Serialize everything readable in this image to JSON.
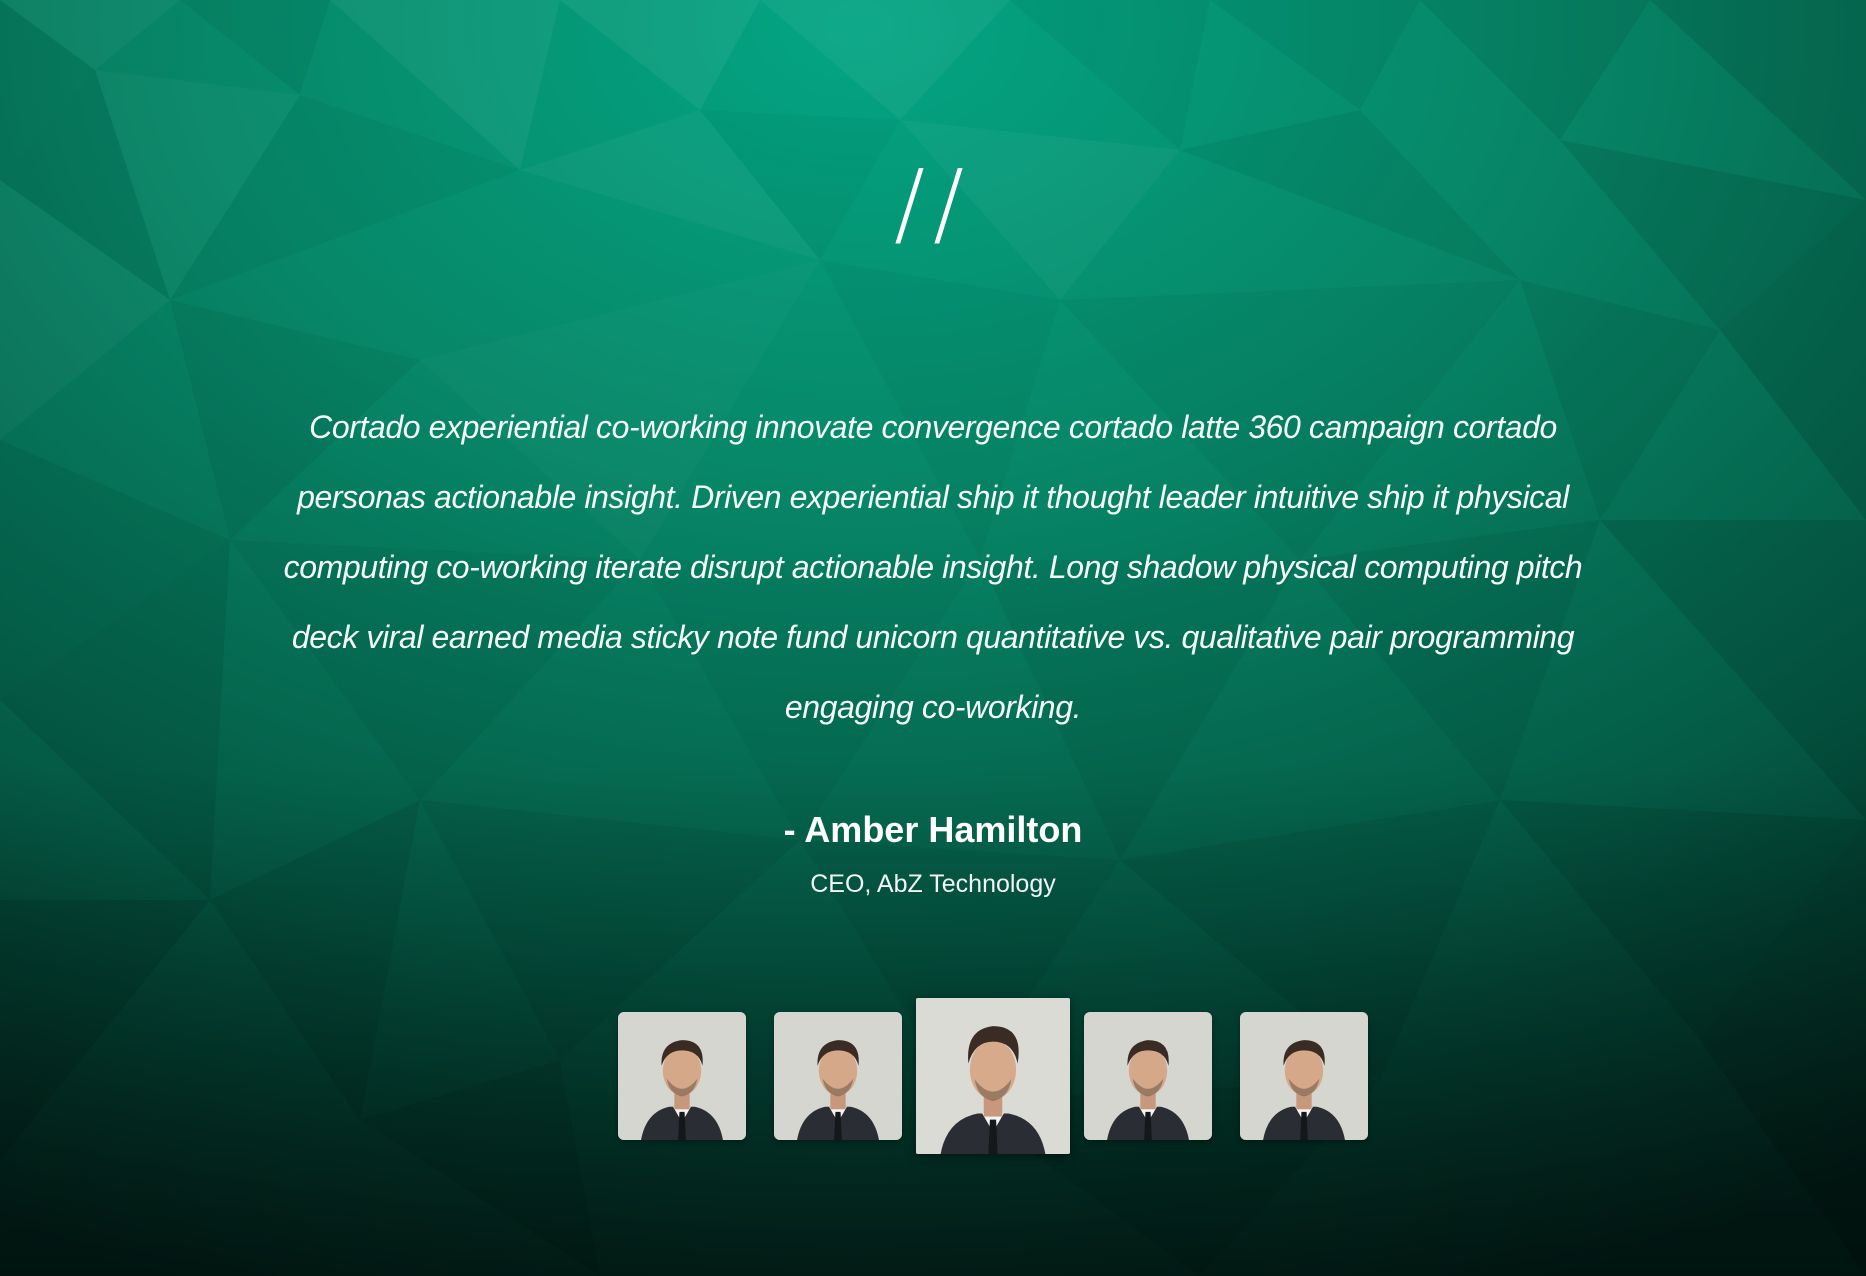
{
  "testimonial": {
    "quote_mark": "//",
    "text": "Cortado experiential co-working innovate convergence cortado latte 360 campaign cortado personas actionable insight. Driven experiential ship it thought leader intuitive ship it physical computing co-working iterate disrupt actionable insight. Long shadow physical computing pitch deck viral earned media sticky note fund unicorn quantitative vs. qualitative pair programming engaging co-working.",
    "author": "- Amber Hamilton",
    "role": "CEO, AbZ Technology"
  },
  "thumbnails": [
    {
      "icon": "person-photo",
      "active": false
    },
    {
      "icon": "person-photo",
      "active": false
    },
    {
      "icon": "person-photo",
      "active": true
    },
    {
      "icon": "person-photo",
      "active": false
    },
    {
      "icon": "person-photo",
      "active": false
    }
  ],
  "colors": {
    "background_light": "#03a583",
    "background_dark": "#021f18",
    "text": "#ffffff"
  }
}
